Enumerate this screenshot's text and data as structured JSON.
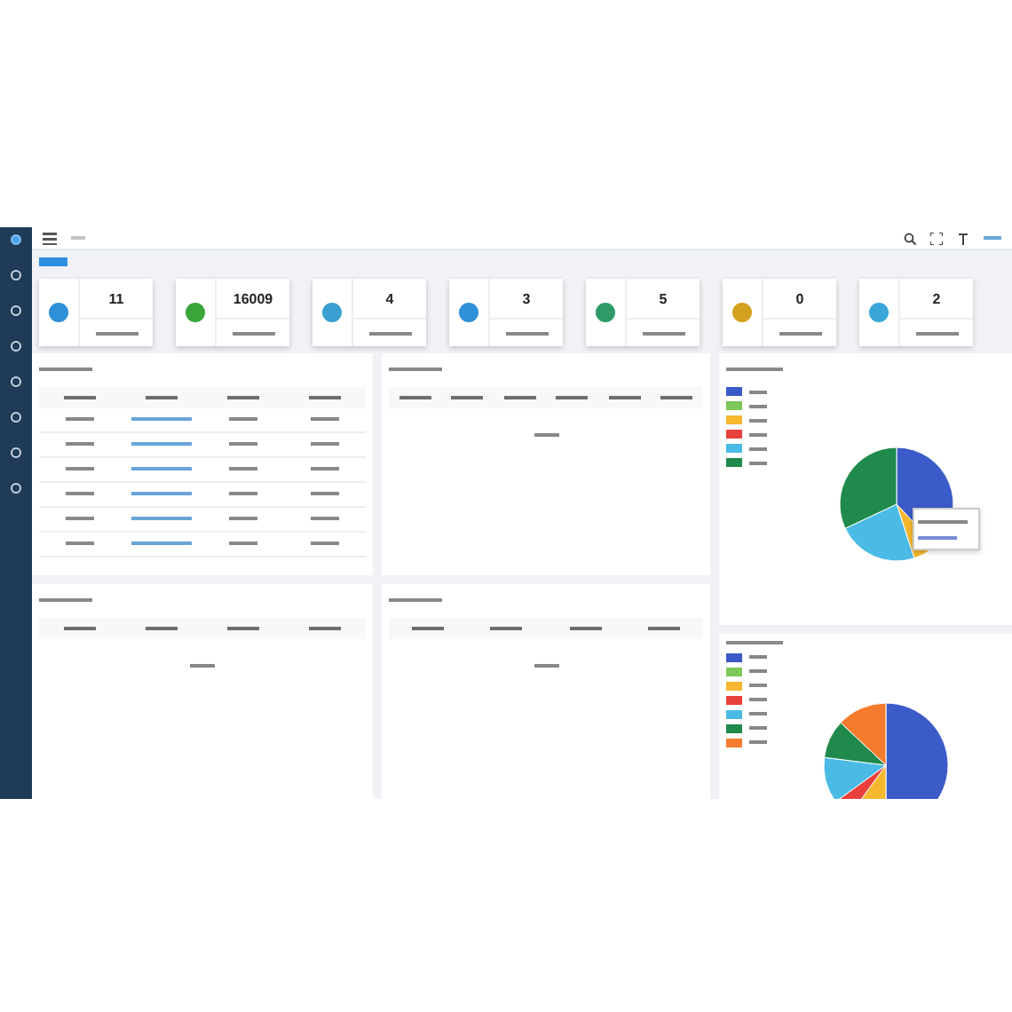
{
  "sidebar": {
    "items": [
      {
        "selected": true
      },
      {
        "selected": false
      },
      {
        "selected": false
      },
      {
        "selected": false
      },
      {
        "selected": false
      },
      {
        "selected": false
      },
      {
        "selected": false
      },
      {
        "selected": false
      }
    ]
  },
  "stat_cards": [
    {
      "value": "11",
      "color": "#2f8fd8"
    },
    {
      "value": "16009",
      "color": "#3aa63a"
    },
    {
      "value": "4",
      "color": "#3a9fd0"
    },
    {
      "value": "3",
      "color": "#2f8fd8"
    },
    {
      "value": "5",
      "color": "#2e9a6a"
    },
    {
      "value": "0",
      "color": "#d4a020"
    },
    {
      "value": "2",
      "color": "#3aa6d8"
    }
  ],
  "panels": [
    {
      "kind": "table",
      "columns": [
        {
          "kind": "header"
        },
        {
          "kind": "header"
        },
        {
          "kind": "header"
        },
        {
          "kind": "header"
        }
      ],
      "rows": [
        {
          "cells": [
            {
              "kind": "plain"
            },
            {
              "kind": "link"
            },
            {
              "kind": "plain"
            },
            {
              "kind": "plain"
            }
          ]
        },
        {
          "cells": [
            {
              "kind": "plain"
            },
            {
              "kind": "link"
            },
            {
              "kind": "plain"
            },
            {
              "kind": "plain"
            }
          ]
        },
        {
          "cells": [
            {
              "kind": "plain"
            },
            {
              "kind": "link"
            },
            {
              "kind": "plain"
            },
            {
              "kind": "plain"
            }
          ]
        },
        {
          "cells": [
            {
              "kind": "plain"
            },
            {
              "kind": "link"
            },
            {
              "kind": "plain"
            },
            {
              "kind": "plain"
            }
          ]
        },
        {
          "cells": [
            {
              "kind": "plain"
            },
            {
              "kind": "link"
            },
            {
              "kind": "plain"
            },
            {
              "kind": "plain"
            }
          ]
        },
        {
          "cells": [
            {
              "kind": "plain"
            },
            {
              "kind": "link"
            },
            {
              "kind": "plain"
            },
            {
              "kind": "plain"
            }
          ]
        }
      ]
    },
    {
      "kind": "empty_table",
      "columns": [
        {
          "kind": "header"
        },
        {
          "kind": "header"
        },
        {
          "kind": "header"
        },
        {
          "kind": "header"
        },
        {
          "kind": "header"
        },
        {
          "kind": "header"
        }
      ]
    },
    {
      "kind": "empty_table",
      "columns": [
        {
          "kind": "header"
        },
        {
          "kind": "header"
        },
        {
          "kind": "header"
        },
        {
          "kind": "header"
        }
      ]
    },
    {
      "kind": "empty_table",
      "columns": [
        {
          "kind": "header"
        },
        {
          "kind": "header"
        },
        {
          "kind": "header"
        },
        {
          "kind": "header"
        }
      ]
    }
  ],
  "pie_panels": [
    {
      "legend": [
        {
          "color": "#3b5bc8"
        },
        {
          "color": "#7cc85a"
        },
        {
          "color": "#f5b82e"
        },
        {
          "color": "#e8413c"
        },
        {
          "color": "#4bbbe6"
        },
        {
          "color": "#1f8a4c"
        }
      ],
      "tooltip": true
    },
    {
      "legend": [
        {
          "color": "#3b5bc8"
        },
        {
          "color": "#7cc85a"
        },
        {
          "color": "#f5b82e"
        },
        {
          "color": "#e8413c"
        },
        {
          "color": "#4bbbe6"
        },
        {
          "color": "#1f8a4c"
        },
        {
          "color": "#f57c2e"
        }
      ],
      "tooltip": false
    }
  ]
}
